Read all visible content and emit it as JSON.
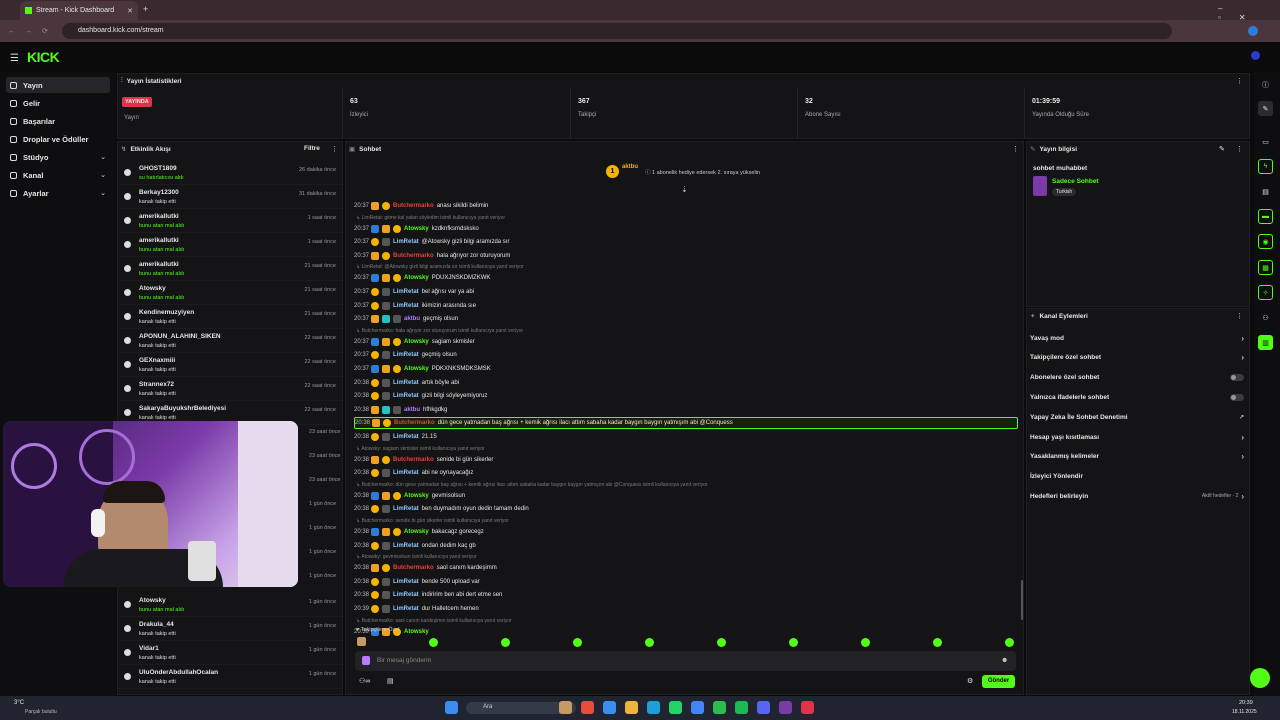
{
  "browser": {
    "tab_title": "Stream - Kick Dashboard",
    "url": "dashboard.kick.com/stream"
  },
  "nav": {
    "logo": "KICK",
    "items": [
      {
        "label": "Yayın"
      },
      {
        "label": "Gelir"
      },
      {
        "label": "Başarılar"
      },
      {
        "label": "Droplar ve Ödüller"
      },
      {
        "label": "Stüdyo"
      },
      {
        "label": "Kanal"
      },
      {
        "label": "Ayarlar"
      }
    ]
  },
  "stats": {
    "title": "Yayın İstatistikleri",
    "live_badge": "YAYINDA",
    "live_label": "Yayın",
    "viewers": "63",
    "viewers_label": "İzleyici",
    "followers": "367",
    "followers_label": "Takipçi",
    "subs": "32",
    "subs_label": "Abone Sayısı",
    "duration": "01:39:59",
    "duration_label": "Yayında Olduğu Süre"
  },
  "activity": {
    "title": "Etkinlik Akışı",
    "filter": "Filtre",
    "events": [
      {
        "name": "GHOST1809",
        "action": "su hatırlatıcısı aldı",
        "time": "26 dakika önce",
        "green": true
      },
      {
        "name": "Berkay12300",
        "action": "kanalı takip etti",
        "time": "31 dakika önce",
        "green": false
      },
      {
        "name": "amerikallutki",
        "action": "bunu atan mal aldı",
        "time": "1 saat önce",
        "green": true
      },
      {
        "name": "amerikallutki",
        "action": "bunu atan mal aldı",
        "time": "1 saat önce",
        "green": true
      },
      {
        "name": "amerikallutki",
        "action": "bunu atan mal aldı",
        "time": "21 saat önce",
        "green": true
      },
      {
        "name": "Atowsky",
        "action": "bunu atan mal aldı",
        "time": "21 saat önce",
        "green": true
      },
      {
        "name": "Kendinemuzyiyen",
        "action": "kanalı takip etti",
        "time": "21 saat önce",
        "green": false
      },
      {
        "name": "APONUN_ALAHINI_SIKEN",
        "action": "kanalı takip etti",
        "time": "22 saat önce",
        "green": false
      },
      {
        "name": "GEXnaxmiii",
        "action": "kanalı takip etti",
        "time": "22 saat önce",
        "green": false
      },
      {
        "name": "Strannex72",
        "action": "kanalı takip etti",
        "time": "22 saat önce",
        "green": false
      },
      {
        "name": "SakaryaBuyukshrBelediyesi",
        "action": "kanalı takip etti",
        "time": "22 saat önce",
        "green": false
      }
    ],
    "hidden_times": [
      "23 saat önce",
      "23 saat önce",
      "23 saat önce",
      "1 gün önce",
      "1 gün önce",
      "1 gün önce",
      "1 gün önce"
    ],
    "events_bottom": [
      {
        "name": "Atowsky",
        "action": "bunu atan mal aldı",
        "time": "1 gün önce",
        "green": true
      },
      {
        "name": "Drakula_44",
        "action": "kanalı takip etti",
        "time": "1 gün önce",
        "green": false
      },
      {
        "name": "Vidar1",
        "action": "kanalı takip etti",
        "time": "1 gün önce",
        "green": false
      },
      {
        "name": "UluOnderAbdullahOcalan",
        "action": "kanalı takip etti",
        "time": "1 gün önce",
        "green": false
      }
    ]
  },
  "chat": {
    "title": "Sohbet",
    "pinned_user": "aktbu",
    "pinned_text": "1 abonelik hediye edersek 2. sıraya yükselin",
    "messages": [
      {
        "t": "20:37",
        "u": "Butchermarko",
        "c": "#e0443a",
        "m": "anası sikildi belimin",
        "reply": ""
      },
      {
        "t": "20:37",
        "u": "Atowsky",
        "c": "#53fc18",
        "m": "kzdknfksmdsksko",
        "reply": "LimRetat: gitme kal yalan söyledim isimli kullanıcıya yanıt veriyor"
      },
      {
        "t": "20:37",
        "u": "LimRetat",
        "c": "#8ec8ff",
        "m": "@Atowsky gizli bilgi aramızda sır",
        "reply": ""
      },
      {
        "t": "20:37",
        "u": "Butchermarko",
        "c": "#e0443a",
        "m": "hala ağrıyor zor oturuyorum",
        "reply": ""
      },
      {
        "t": "20:37",
        "u": "Atowsky",
        "c": "#53fc18",
        "m": "PDUXJNSKDMZKWK",
        "reply": "LimRetat: @Atowsky gizli bilgi aramızda sır isimli kullanıcıya yanıt veriyor"
      },
      {
        "t": "20:37",
        "u": "LimRetat",
        "c": "#8ec8ff",
        "m": "bel ağrısı var ya abi",
        "reply": ""
      },
      {
        "t": "20:37",
        "u": "LimRetat",
        "c": "#8ec8ff",
        "m": "ikimizin arasında sıe",
        "reply": ""
      },
      {
        "t": "20:37",
        "u": "aktbu",
        "c": "#b77bff",
        "m": "geçmiş olsun",
        "reply": ""
      },
      {
        "t": "20:37",
        "u": "Atowsky",
        "c": "#53fc18",
        "m": "sagiam skmisler",
        "reply": "Butchermarko: hala ağrıyor zor oturuyorum isimli kullanıcıya yanıt veriyor"
      },
      {
        "t": "20:37",
        "u": "LimRetat",
        "c": "#8ec8ff",
        "m": "geçmiş olsun",
        "reply": ""
      },
      {
        "t": "20:37",
        "u": "Atowsky",
        "c": "#53fc18",
        "m": "PDKXNKSMDKSMSK",
        "reply": ""
      },
      {
        "t": "20:38",
        "u": "LimRetat",
        "c": "#8ec8ff",
        "m": "artık böyle abi",
        "reply": ""
      },
      {
        "t": "20:38",
        "u": "LimRetat",
        "c": "#8ec8ff",
        "m": "gizli bilgi söyleyemiyoruz",
        "reply": ""
      },
      {
        "t": "20:38",
        "u": "aktbu",
        "c": "#b77bff",
        "m": "hfhkgdkg",
        "reply": ""
      },
      {
        "t": "20:38",
        "u": "Butchermarko",
        "c": "#e0443a",
        "m": "dün gece yatmadan baş ağrısı + kemik ağrısı ilacı attım sabaha kadar baygın baygın yatmışım abi @Conquess",
        "reply": ""
      },
      {
        "t": "20:38",
        "u": "LimRetat",
        "c": "#8ec8ff",
        "m": "21.15",
        "reply": ""
      },
      {
        "t": "20:38",
        "u": "Butchermarko",
        "c": "#e0443a",
        "m": "senide bi gün sikerler",
        "reply": "Atowsky: sagiam skmisler isimli kullanıcıya yanıt veriyor"
      },
      {
        "t": "20:38",
        "u": "LimRetat",
        "c": "#8ec8ff",
        "m": "abi ne oynayacağız",
        "reply": ""
      },
      {
        "t": "20:38",
        "u": "Atowsky",
        "c": "#53fc18",
        "m": "gevmisolsun",
        "reply": "Butchermarko: dün gece yatmadan baş ağrısı + kemik ağrısı ilacı attım sabaha kadar baygın baygın yatmışım abi @Conquess isimli kullanıcıya yanıt veriyor"
      },
      {
        "t": "20:38",
        "u": "LimRetat",
        "c": "#8ec8ff",
        "m": "ben duymadım oyun dedin tamam dedin",
        "reply": ""
      },
      {
        "t": "20:38",
        "u": "Atowsky",
        "c": "#53fc18",
        "m": "bakacagz gorecegz",
        "reply": "Butchermarko: senide bi gün sikerler isimli kullanıcıya yanıt veriyor"
      },
      {
        "t": "20:38",
        "u": "LimRetat",
        "c": "#8ec8ff",
        "m": "ondan dedim kaç gb",
        "reply": ""
      },
      {
        "t": "20:38",
        "u": "Butchermarko",
        "c": "#e0443a",
        "m": "saol canım kardeşimm",
        "reply": "Atowsky: gevmisolsun isimli kullanıcıya yanıt veriyor"
      },
      {
        "t": "20:38",
        "u": "LimRetat",
        "c": "#8ec8ff",
        "m": "bende 500 upload var",
        "reply": ""
      },
      {
        "t": "20:38",
        "u": "LimRetat",
        "c": "#8ec8ff",
        "m": "indiririm ben abi dert etme sen",
        "reply": ""
      },
      {
        "t": "20:39",
        "u": "LimRetat",
        "c": "#8ec8ff",
        "m": "dur Halletcem hemen",
        "reply": ""
      },
      {
        "t": "20:39",
        "u": "Atowsky",
        "c": "#53fc18",
        "m": "",
        "reply": "Butchermarko: saol canım kardeşimm isimli kullanıcıya yanıt veriyor"
      }
    ],
    "mode": "Takipçilere Özel",
    "placeholder": "Bir mesaj gönderin",
    "send": "Gönder"
  },
  "stream_info": {
    "title": "Yayın bilgisi",
    "stream_title": "sohbet muhabbet",
    "category": "Sadece Sohbet",
    "tag": "Turkish"
  },
  "channel_actions": {
    "title": "Kanal Eylemleri",
    "items": [
      {
        "label": "Yavaş mod",
        "kind": "chev"
      },
      {
        "label": "Takipçilere özel sohbet",
        "kind": "chev"
      },
      {
        "label": "Abonelere özel sohbet",
        "kind": "toggle"
      },
      {
        "label": "Yalnızca ifadelerle sohbet",
        "kind": "toggle"
      },
      {
        "label": "Yapay Zeka İle Sohbet Denetimi",
        "kind": "ext"
      },
      {
        "label": "Hesap yaşı kısıtlaması",
        "kind": "chev"
      },
      {
        "label": "Yasaklanmış kelimeler",
        "kind": "chev"
      },
      {
        "label": "İzleyici Yönlendir",
        "kind": "none"
      },
      {
        "label": "Hedefleri belirleyin",
        "kind": "goal"
      }
    ],
    "goal_status": "Aktif hedefler · 2"
  },
  "taskbar": {
    "weather_temp": "3°C",
    "weather_text": "Parçalı bulutlu",
    "search": "Ara",
    "time": "20:39",
    "date": "18.11.2025"
  },
  "colors": {
    "accent": "#53fc18",
    "live": "#e0324b"
  }
}
